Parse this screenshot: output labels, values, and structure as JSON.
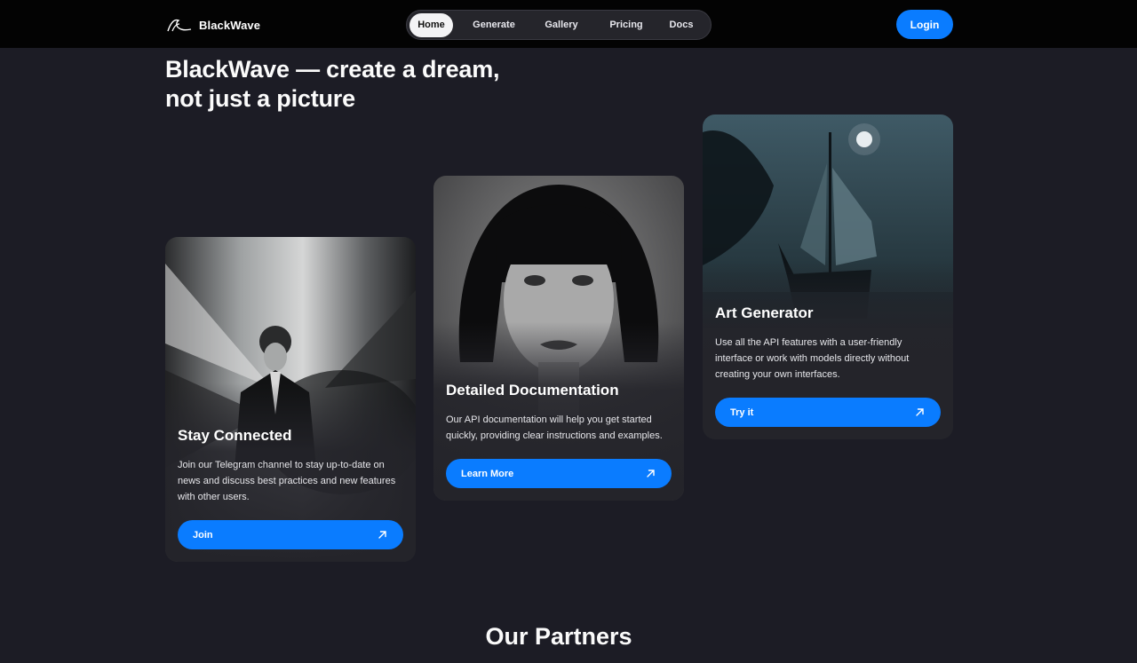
{
  "brand": {
    "name": "BlackWave",
    "logo_icon": "wave-icon"
  },
  "nav": {
    "items": [
      {
        "label": "Home",
        "active": true
      },
      {
        "label": "Generate",
        "active": false
      },
      {
        "label": "Gallery",
        "active": false
      },
      {
        "label": "Pricing",
        "active": false
      },
      {
        "label": "Docs",
        "active": false
      }
    ]
  },
  "header": {
    "login_label": "Login"
  },
  "hero": {
    "title_line1": "BlackWave — create a dream,",
    "title_line2": "not just a picture"
  },
  "cards": [
    {
      "title": "Stay Connected",
      "description": "Join our Telegram channel to stay up-to-date on news and discuss best practices and new features with other users.",
      "button_label": "Join",
      "button_icon": "arrow-up-right-icon"
    },
    {
      "title": "Detailed Documentation",
      "description": "Our API documentation will help you get started quickly, providing clear instructions and examples.",
      "button_label": "Learn More",
      "button_icon": "arrow-up-right-icon"
    },
    {
      "title": "Art Generator",
      "description": "Use all the API features with a user-friendly interface or work with models directly without creating your own interfaces.",
      "button_label": "Try it",
      "button_icon": "arrow-up-right-icon"
    }
  ],
  "partners": {
    "title": "Our Partners"
  },
  "colors": {
    "accent": "#0a7cff",
    "background": "#1c1c25",
    "topbar": "#030303"
  }
}
